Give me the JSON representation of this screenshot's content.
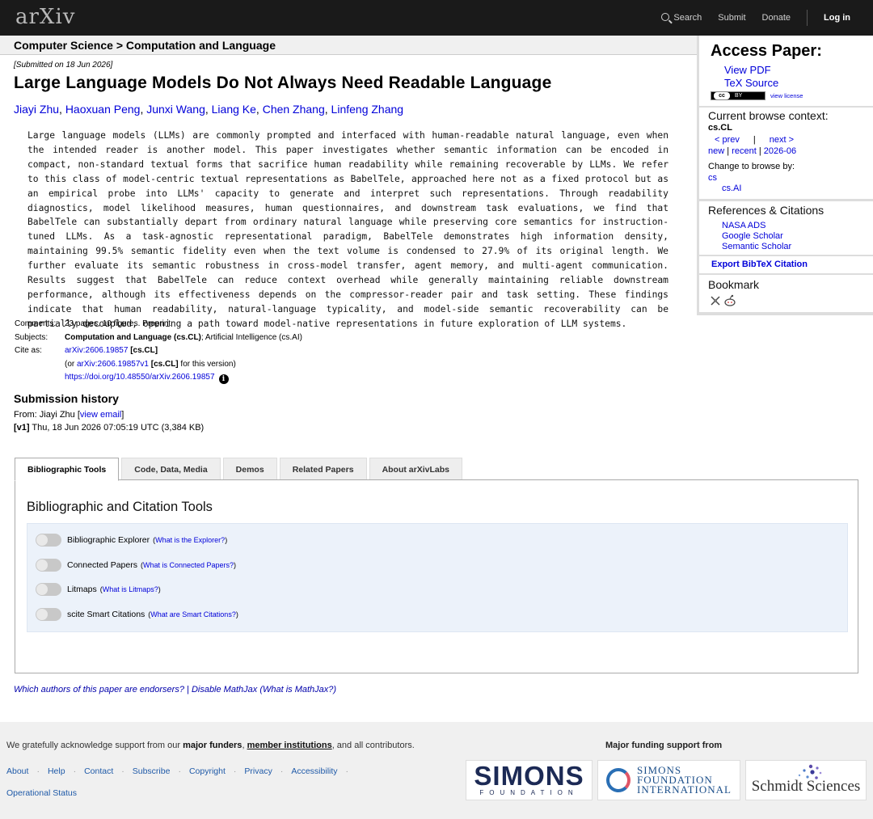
{
  "header": {
    "logo_text": "arXiv",
    "nav": {
      "search": "Search",
      "submit": "Submit",
      "donate": "Donate",
      "login": "Log in"
    }
  },
  "breadcrumb": "Computer Science > Computation and Language",
  "paper": {
    "submitted": "[Submitted on 18 Jun 2026]",
    "title": "Large Language Models Do Not Always Need Readable Language",
    "authors": [
      "Jiayi Zhu",
      "Haoxuan Peng",
      "Junxi Wang",
      "Liang Ke",
      "Chen Zhang",
      "Linfeng Zhang"
    ],
    "abstract": "Large language models (LLMs) are commonly prompted and interfaced with human-readable natural language, even when the intended reader is another model. This paper investigates whether semantic information can be encoded in compact, non-standard textual forms that sacrifice human readability while remaining recoverable by LLMs. We refer to this class of model-centric textual representations as BabelTele, approached here not as a fixed protocol but as an empirical probe into LLMs' capacity to generate and interpret such representations. Through readability diagnostics, model likelihood measures, human questionnaires, and downstream task evaluations, we find that BabelTele can substantially depart from ordinary natural language while preserving core semantics for instruction-tuned LLMs. As a task-agnostic representational paradigm, BabelTele demonstrates high information density, maintaining 99.5% semantic fidelity even when the text volume is condensed to 27.9% of its original length. We further evaluate its semantic robustness in cross-model transfer, agent memory, and multi-agent communication. Results suggest that BabelTele can reduce context overhead while generally maintaining reliable downstream performance, although its effectiveness depends on the compressor-reader pair and task setting. These findings indicate that human readability, natural-language typicality, and model-side semantic recoverability can be partially decoupled, opening a path toward model-native representations in future exploration of LLM systems.",
    "comments_label": "Comments:",
    "comments": "23 pages, 10 figures. Preprint",
    "subjects_label": "Subjects:",
    "subjects_primary": "Computation and Language (cs.CL)",
    "subjects_rest": "; Artificial Intelligence (cs.AI)",
    "cite_label": "Cite as:",
    "cite_id": "arXiv:2606.19857",
    "cite_cat": "[cs.CL]",
    "cite_or": "(or ",
    "cite_v1": "arXiv:2606.19857v1",
    "cite_v1_cat": "[cs.CL]",
    "cite_version": " for this version)",
    "doi": "https://doi.org/10.48550/arXiv.2606.19857",
    "info_glyph": "i"
  },
  "history": {
    "heading": "Submission history",
    "from_prefix": "From: Jiayi Zhu [",
    "view_email": "view email",
    "from_suffix": "]",
    "v1_label": "[v1]",
    "v1_text": " Thu, 18 Jun 2026 07:05:19 UTC (3,384 KB)"
  },
  "tabs": [
    "Bibliographic Tools",
    "Code, Data, Media",
    "Demos",
    "Related Papers",
    "About arXivLabs"
  ],
  "panel": {
    "title": "Bibliographic and Citation Tools",
    "tools": [
      {
        "label": "Bibliographic Explorer",
        "help": "What is the Explorer?"
      },
      {
        "label": "Connected Papers",
        "help": "What is Connected Papers?"
      },
      {
        "label": "Litmaps",
        "help": "What is Litmaps?"
      },
      {
        "label": "scite Smart Citations",
        "help": "What are Smart Citations?"
      }
    ]
  },
  "endorse": {
    "q": "Which authors of this paper are endorsers?",
    "sep": " | ",
    "mathjax": "Disable MathJax",
    "what": "(What is MathJax?)"
  },
  "sidebar": {
    "access_heading": "Access Paper:",
    "view_pdf": "View PDF",
    "tex_source": "TeX Source",
    "cc_badge": "cc",
    "cc_by": "BY",
    "view_license": "view license",
    "context_heading": "Current browse context:",
    "context": "cs.CL",
    "prev": "< prev",
    "pipe": "|",
    "next": "next >",
    "new": "new",
    "recent": "recent",
    "month": "2026-06",
    "change_browse": "Change to browse by:",
    "browse_cs": "cs",
    "browse_csai": "cs.AI",
    "refs_heading": "References & Citations",
    "nasa": "NASA ADS",
    "google": "Google Scholar",
    "semantic": "Semantic Scholar",
    "bibtex": "Export BibTeX Citation",
    "bookmark_heading": "Bookmark"
  },
  "footer": {
    "ack_prefix": "We gratefully acknowledge support from our ",
    "major_funders": "major funders",
    "comma": ", ",
    "member_institutions": "member institutions",
    "ack_suffix": ", and all contributors.",
    "links": [
      "About",
      "Help",
      "Contact",
      "Subscribe",
      "Copyright",
      "Privacy",
      "Accessibility"
    ],
    "op_status": "Operational Status",
    "major_funding": "Major funding support from",
    "simons_big": "SIMONS",
    "simons_small": "FOUNDATION",
    "sfi_line1": "SIMONS",
    "sfi_line2": "FOUNDATION",
    "sfi_line3": "INTERNATIONAL",
    "schmidt": "Schmidt Sciences"
  }
}
